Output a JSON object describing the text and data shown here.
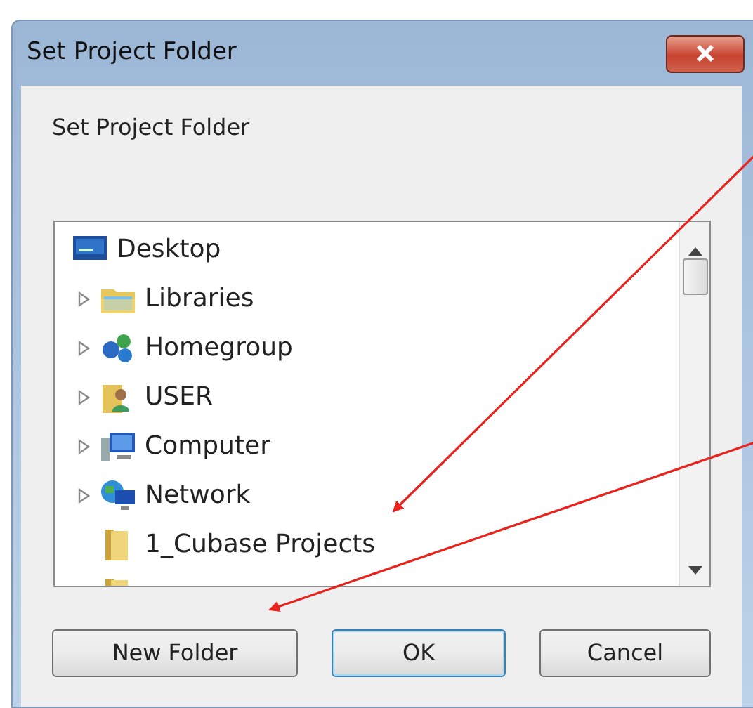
{
  "window": {
    "title": "Set Project Folder"
  },
  "prompt": "Set Project Folder",
  "tree": {
    "items": [
      {
        "label": "Desktop",
        "kind": "desktop",
        "expandable": false,
        "children": [
          {
            "label": "Libraries",
            "kind": "libraries",
            "expandable": true
          },
          {
            "label": "Homegroup",
            "kind": "homegroup",
            "expandable": true
          },
          {
            "label": "USER",
            "kind": "user",
            "expandable": true
          },
          {
            "label": "Computer",
            "kind": "computer",
            "expandable": true
          },
          {
            "label": "Network",
            "kind": "network",
            "expandable": true
          },
          {
            "label": "1_Cubase Projects",
            "kind": "folder",
            "expandable": false
          },
          {
            "kind": "folder",
            "expandable": false
          }
        ]
      }
    ]
  },
  "buttons": [
    {
      "label": "New Folder",
      "default": false
    },
    {
      "label": "OK",
      "default": true
    },
    {
      "label": "Cancel",
      "default": false
    }
  ]
}
